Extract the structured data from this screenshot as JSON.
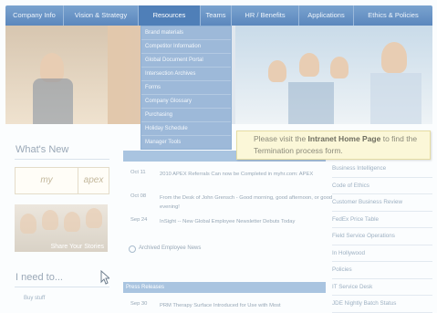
{
  "nav": {
    "items": [
      "Company Info",
      "Vision & Strategy",
      "Resources",
      "Teams",
      "HR / Benefits",
      "Applications",
      "Ethics & Policies"
    ],
    "active": "Resources"
  },
  "dropdown": {
    "items": [
      "Brand materials",
      "Competitor Information",
      "Global Document Portal",
      "Intersection Archives",
      "Forms",
      "Company Glossary",
      "Purchasing",
      "Holiday Schedule",
      "Manager Tools"
    ]
  },
  "tooltip": {
    "prefix": "Please visit the ",
    "link": "Intranet Home Page",
    "suffix": " to find the Termination process form."
  },
  "left": {
    "whats_new": "What's New",
    "my": "my",
    "apex": "apex",
    "share_stories": "Share Your Stories",
    "need_to": "I need to...",
    "buy_stuff": "Buy stuff"
  },
  "news": {
    "rows": [
      {
        "date": "Oct 11",
        "text": "2010 APEX Referrals Can now be Completed in myhr.com: APEX"
      },
      {
        "date": "Oct 08",
        "text": "From the Desk of John Grensch - Good morning, good afternoon, or good evening!"
      },
      {
        "date": "Sep 24",
        "text": "InSight -- New Global Employee Newsletter Debuts Today"
      }
    ],
    "archived": "Archived Employee News"
  },
  "press": {
    "header": "Press Releases",
    "row": {
      "date": "Sep 30",
      "text": "PRM Therapy Surface Introduced for Use with Most"
    }
  },
  "right_list": {
    "items": [
      "Business Intelligence",
      "Code of Ethics",
      "Customer Business Review",
      "FedEx Price Table",
      "Field Service Operations",
      "In Hollywood",
      "Policies",
      "IT Service Desk",
      "JDE Nightly Batch Status"
    ]
  },
  "colors": {
    "nav": "#5b87bd",
    "dropdown": "#9db9d9",
    "tooltip_bg": "#fbf7d8"
  }
}
